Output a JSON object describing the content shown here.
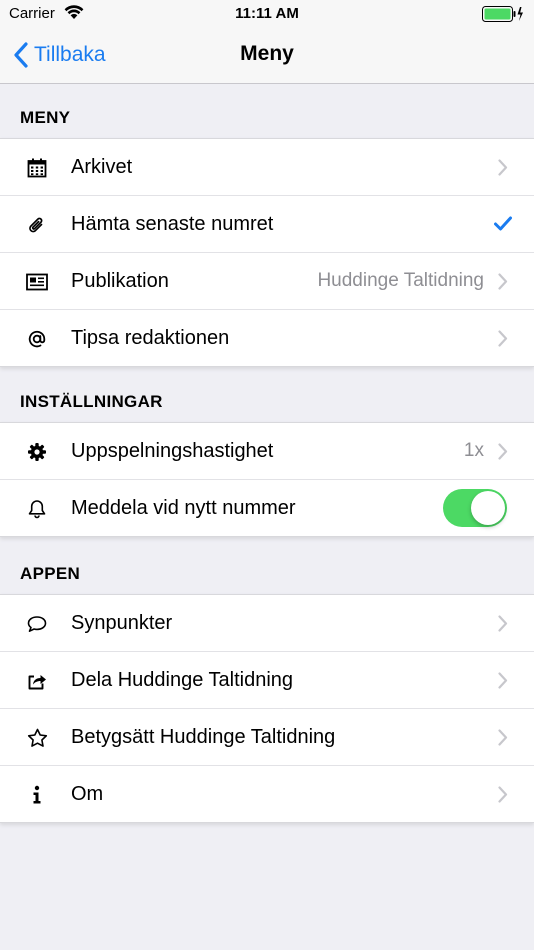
{
  "statusbar": {
    "carrier": "Carrier",
    "time": "11:11 AM"
  },
  "navbar": {
    "back_label": "Tillbaka",
    "title": "Meny"
  },
  "colors": {
    "accent": "#1a7cf0",
    "toggle_on": "#4cd964",
    "battery": "#4cd964"
  },
  "sections": [
    {
      "header": "MENY",
      "items": [
        {
          "label": "Arkivet",
          "icon": "calendar-icon",
          "accessory": "chevron"
        },
        {
          "label": "Hämta senaste numret",
          "icon": "paperclip-icon",
          "accessory": "checkmark"
        },
        {
          "label": "Publikation",
          "icon": "newspaper-icon",
          "value": "Huddinge Taltidning",
          "accessory": "chevron"
        },
        {
          "label": "Tipsa redaktionen",
          "icon": "at-icon",
          "accessory": "chevron"
        }
      ]
    },
    {
      "header": "INSTÄLLNINGAR",
      "items": [
        {
          "label": "Uppspelningshastighet",
          "icon": "gear-icon",
          "value": "1x",
          "accessory": "chevron"
        },
        {
          "label": "Meddela vid nytt nummer",
          "icon": "bell-icon",
          "accessory": "toggle",
          "toggle_on": true
        }
      ]
    },
    {
      "header": "APPEN",
      "items": [
        {
          "label": "Synpunkter",
          "icon": "speech-bubble-icon",
          "accessory": "chevron"
        },
        {
          "label": "Dela Huddinge Taltidning",
          "icon": "share-icon",
          "accessory": "chevron"
        },
        {
          "label": "Betygsätt Huddinge Taltidning",
          "icon": "star-icon",
          "accessory": "chevron"
        },
        {
          "label": "Om",
          "icon": "info-icon",
          "accessory": "chevron"
        }
      ]
    }
  ]
}
